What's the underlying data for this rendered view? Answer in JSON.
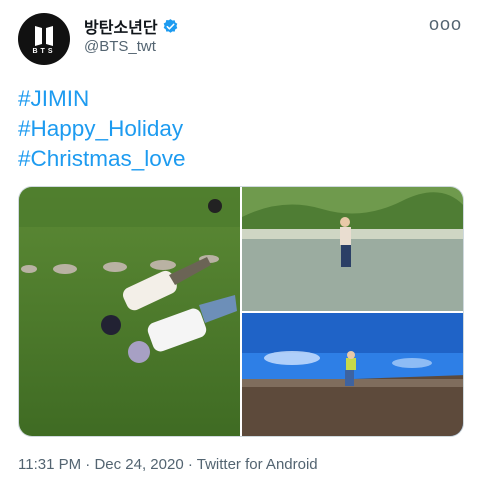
{
  "account": {
    "avatar_text": "BTS",
    "display_name": "방탄소년단",
    "handle": "@BTS_twt"
  },
  "more_label": "ooo",
  "hashtags": [
    "#JIMIN",
    "#Happy_Holiday",
    "#Christmas_love"
  ],
  "media": {
    "icons": [
      "photo-lying-on-grass",
      "photo-standing-in-river",
      "photo-sitting-on-roof"
    ]
  },
  "meta": {
    "time": "11:31 PM",
    "separator": "·",
    "date": "Dec 24, 2020",
    "client": "Twitter for Android"
  },
  "colors": {
    "link": "#1d9bf0",
    "muted": "#536471",
    "verified": "#1d9bf0"
  }
}
